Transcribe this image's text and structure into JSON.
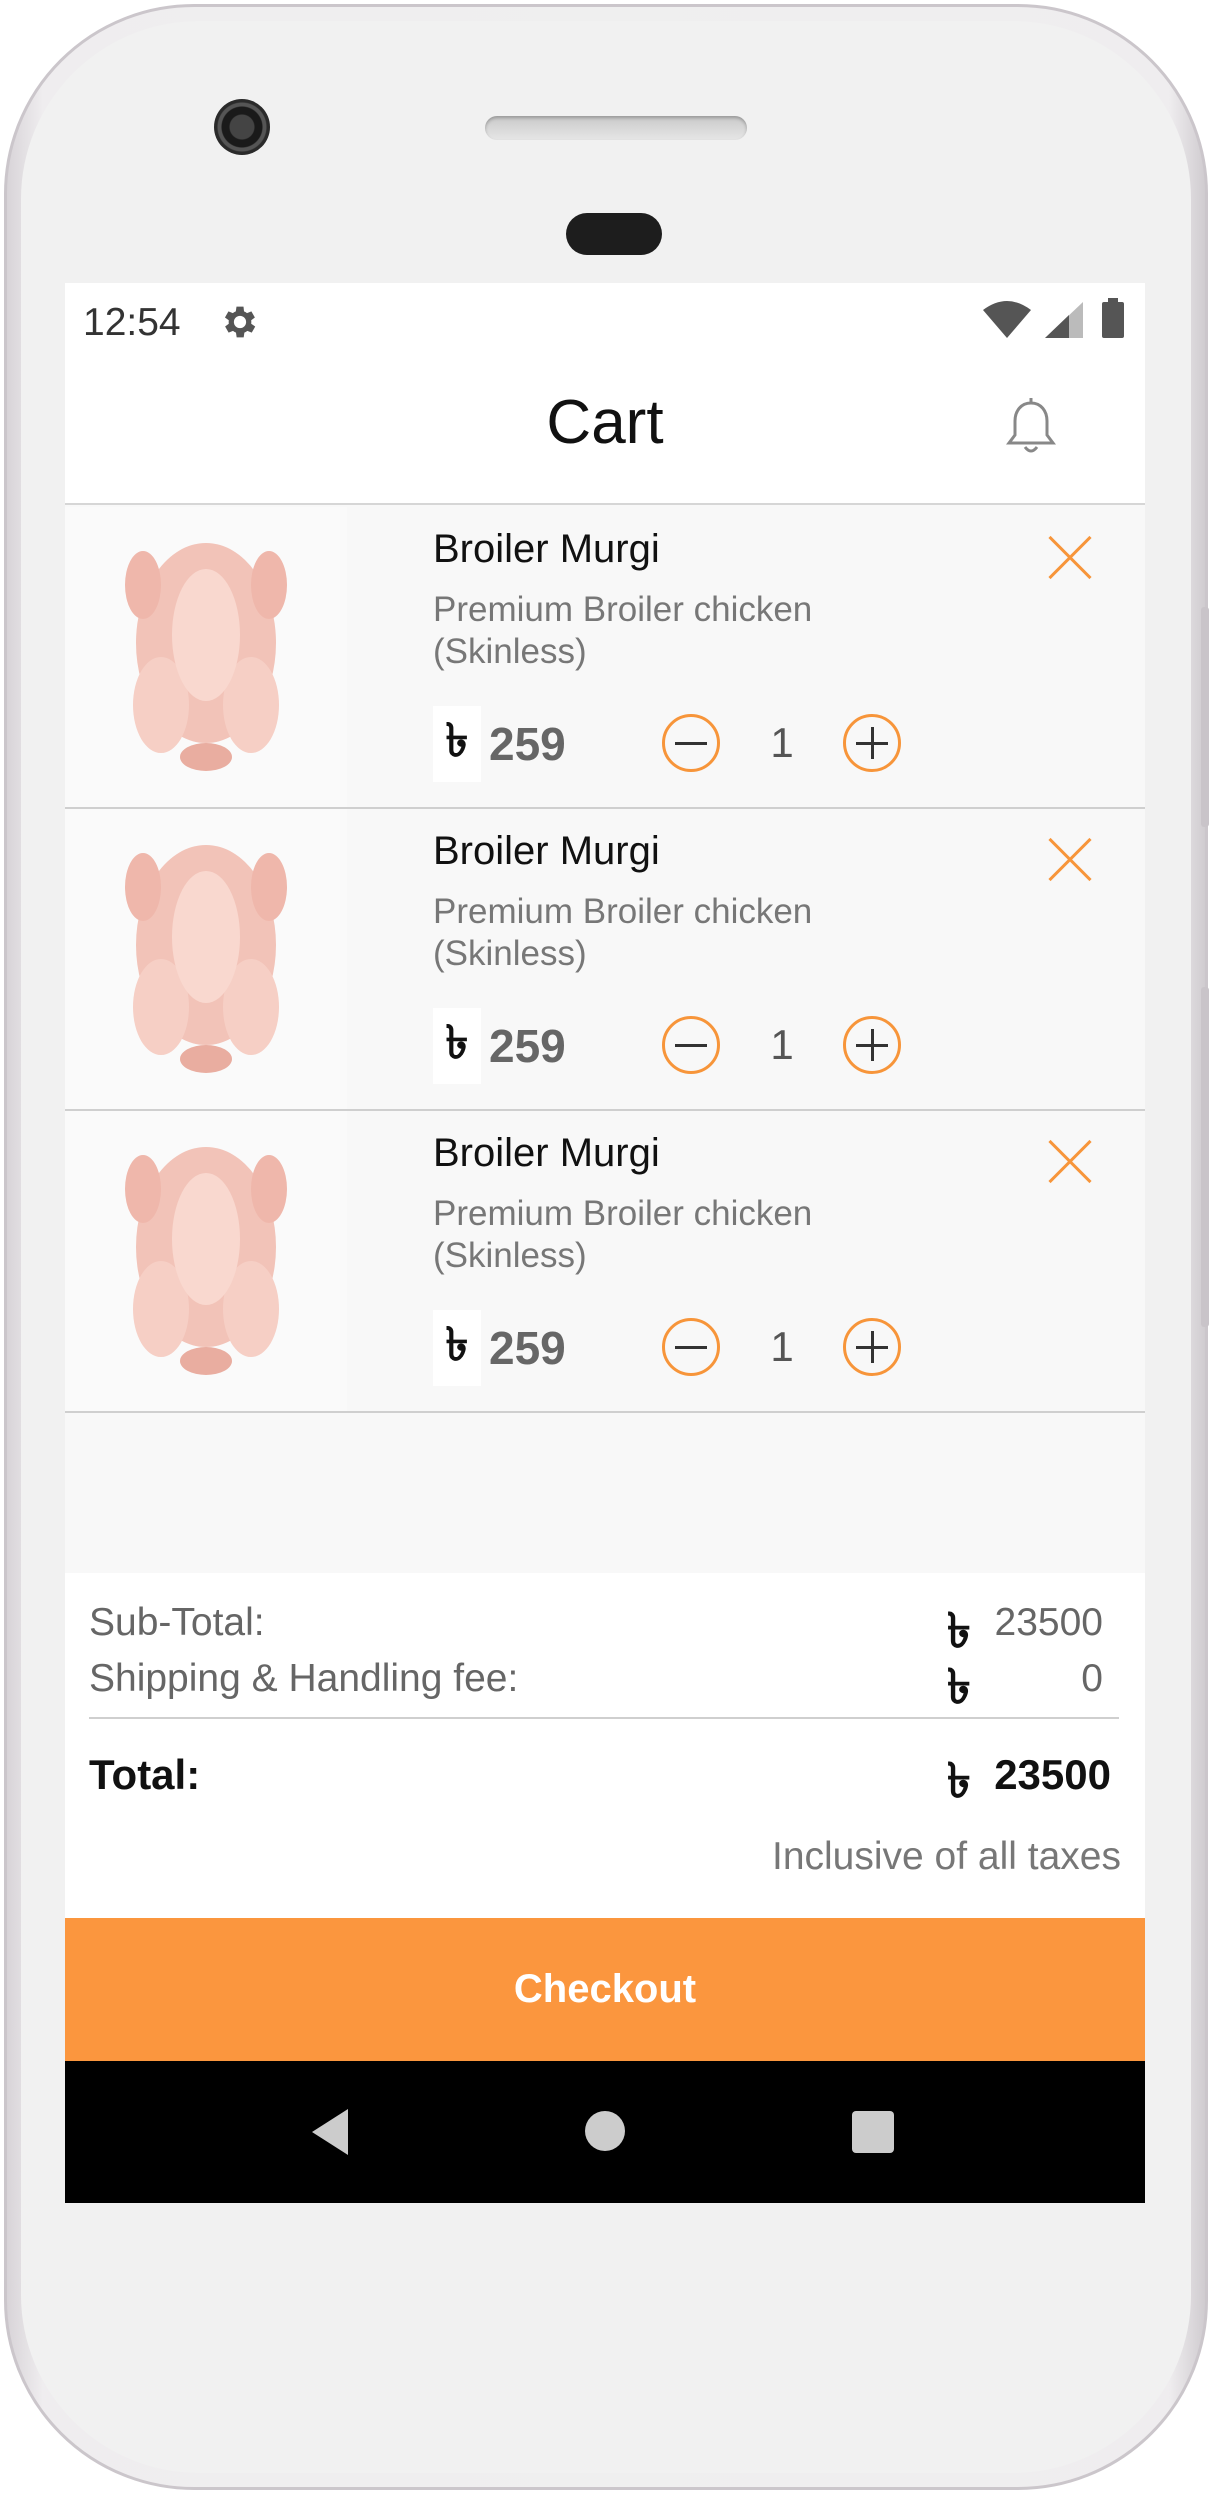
{
  "status_bar": {
    "time": "12:54"
  },
  "app_bar": {
    "title": "Cart"
  },
  "cart_items": [
    {
      "name": "Broiler Murgi",
      "description": "Premium Broiler chicken (Skinless)",
      "currency": "৳",
      "price": "259",
      "quantity": "1"
    },
    {
      "name": "Broiler Murgi",
      "description": "Premium Broiler chicken (Skinless)",
      "currency": "৳",
      "price": "259",
      "quantity": "1"
    },
    {
      "name": "Broiler Murgi",
      "description": "Premium Broiler chicken (Skinless)",
      "currency": "৳",
      "price": "259",
      "quantity": "1"
    }
  ],
  "summary": {
    "subtotal_label": "Sub-Total:",
    "subtotal_currency": "৳",
    "subtotal_value": "23500",
    "shipping_label": "Shipping & Handling fee:",
    "shipping_currency": "৳",
    "shipping_value": "0",
    "total_label": "Total:",
    "total_currency": "৳",
    "total_value": "23500",
    "note": "Inclusive of all taxes"
  },
  "checkout": {
    "label": "Checkout"
  },
  "colors": {
    "accent": "#fb963e",
    "navbar": "#000000"
  }
}
